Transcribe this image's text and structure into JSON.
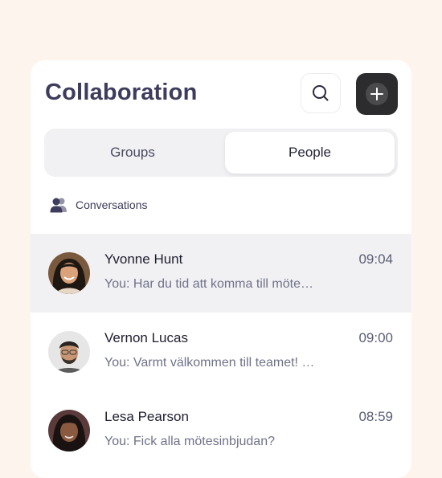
{
  "header": {
    "title": "Collaboration"
  },
  "tabs": {
    "groups_label": "Groups",
    "people_label": "People",
    "selected": "People"
  },
  "section": {
    "label": "Conversations",
    "icon": "users-icon"
  },
  "conversations": [
    {
      "name": "Yvonne Hunt",
      "time": "09:04",
      "message": "You: Har du tid att komma till möte…",
      "selected": true
    },
    {
      "name": "Vernon Lucas",
      "time": "09:00",
      "message": "You: Varmt välkommen till teamet! …",
      "selected": false
    },
    {
      "name": "Lesa Pearson",
      "time": "08:59",
      "message": "You: Fick alla mötesinbjudan?",
      "selected": false
    }
  ],
  "colors": {
    "background": "#fdf4ee",
    "title": "#3d3c5c",
    "add_button": "#2c2c2e",
    "selected_row": "#f1f1f3"
  }
}
